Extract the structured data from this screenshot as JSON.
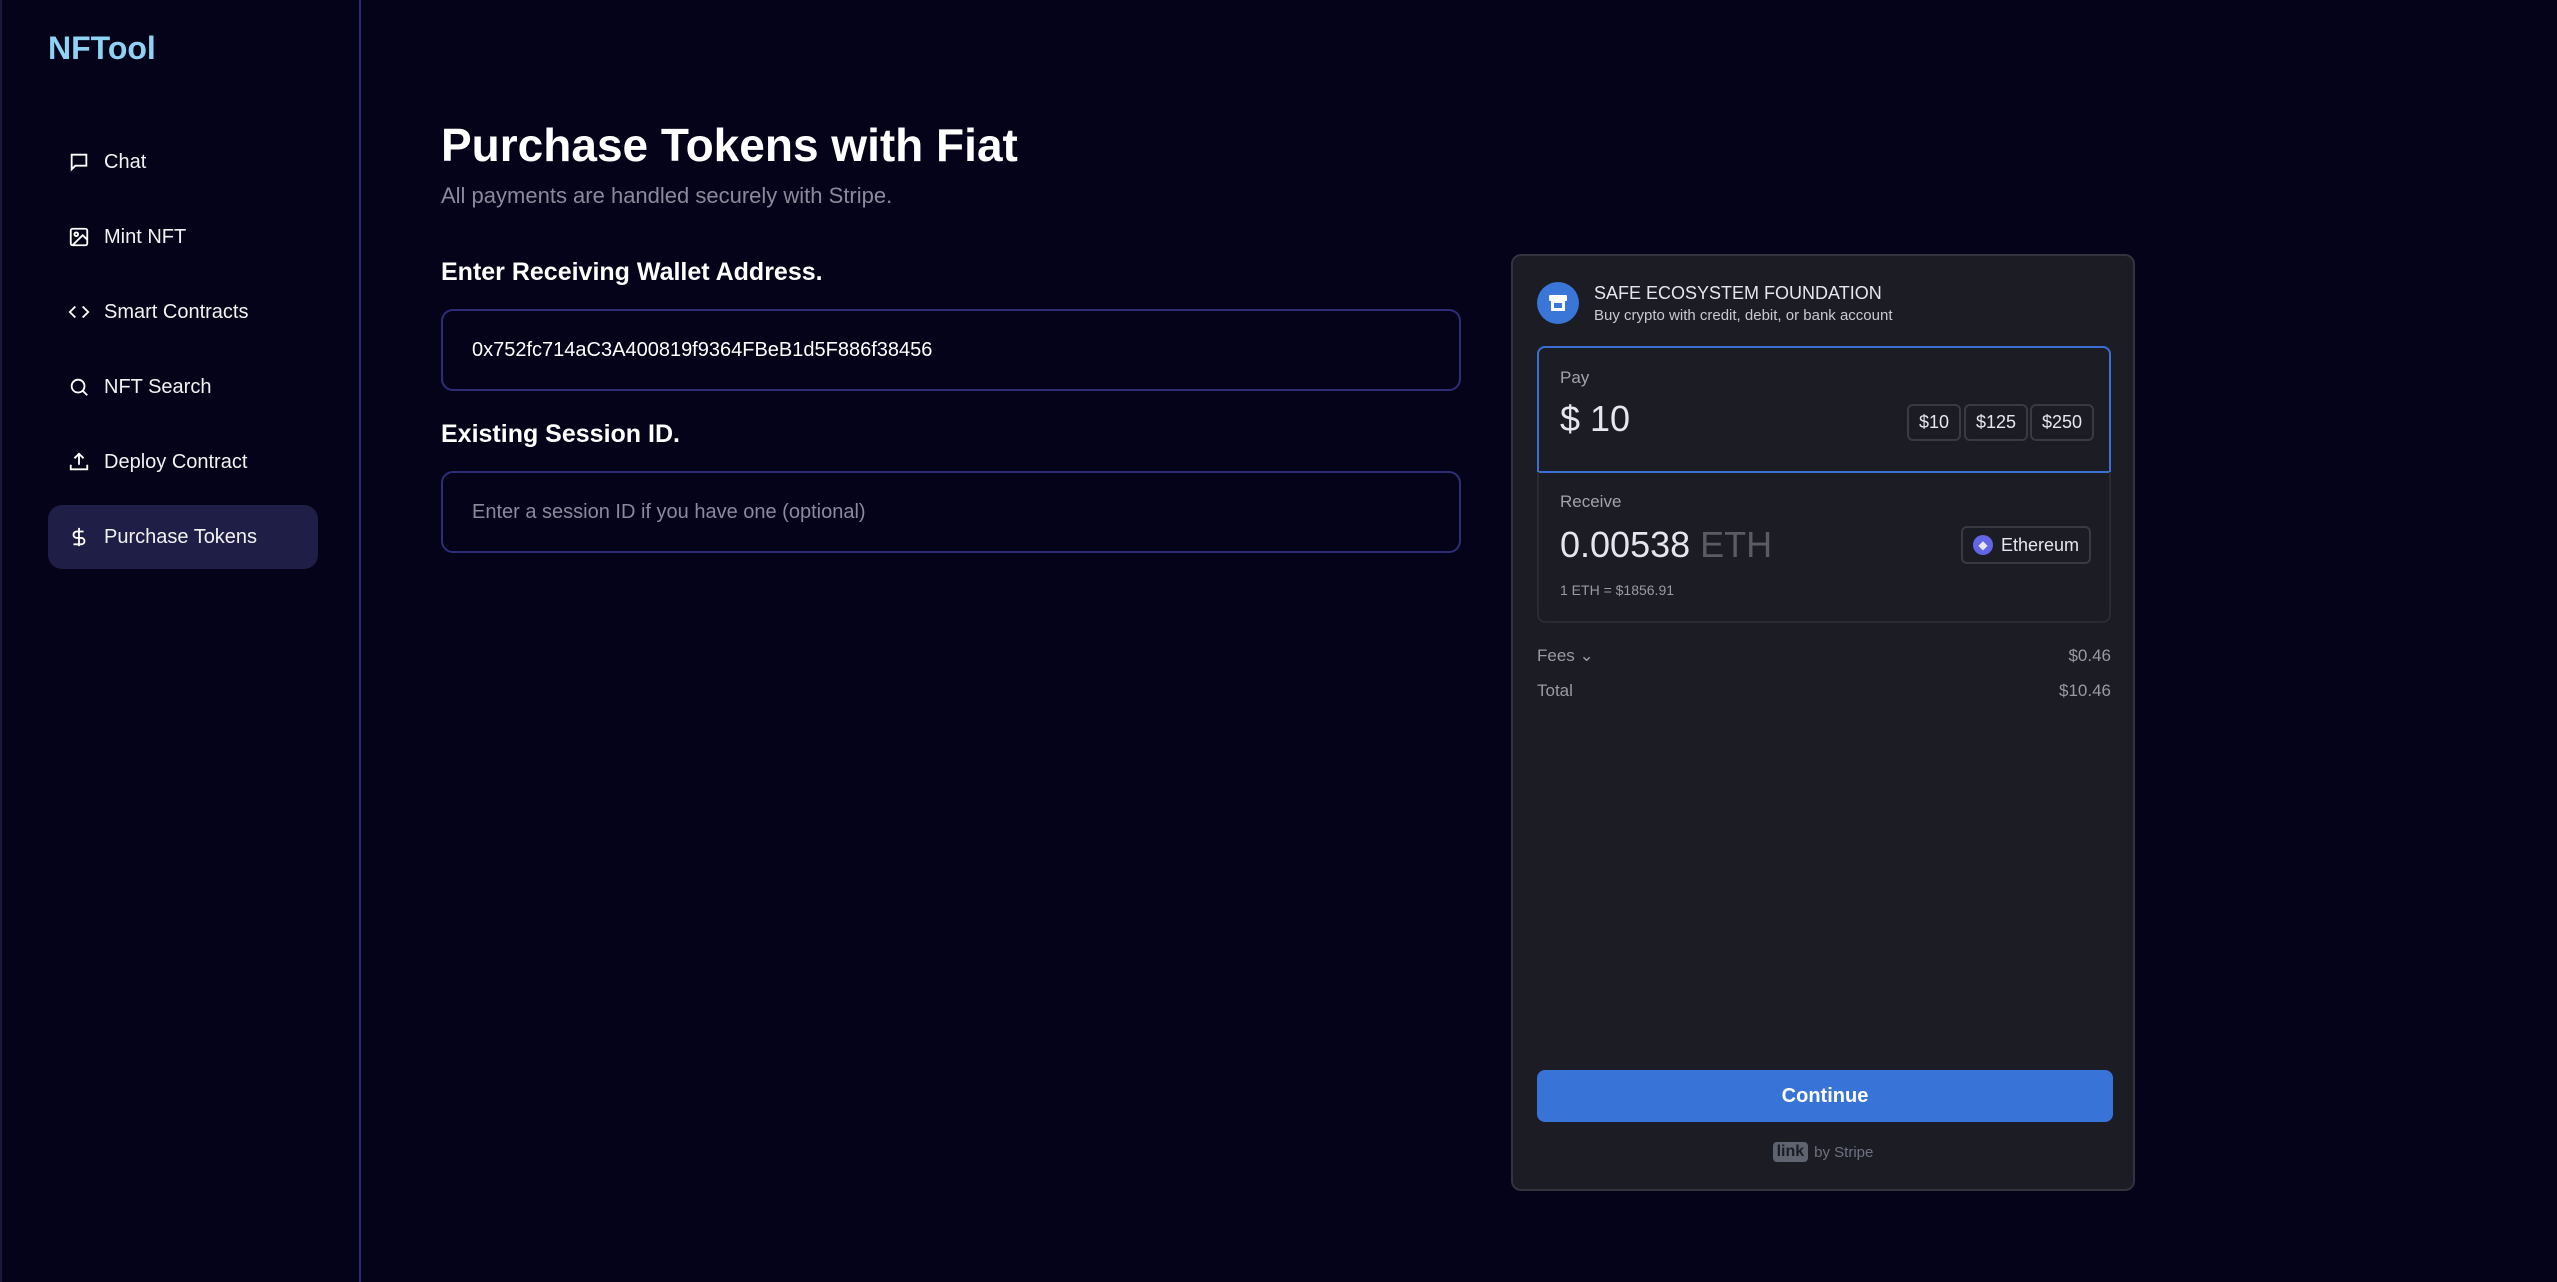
{
  "app": {
    "logo": "NFTool"
  },
  "sidebar": {
    "items": [
      {
        "label": "Chat",
        "icon": "chat-icon"
      },
      {
        "label": "Mint NFT",
        "icon": "image-icon"
      },
      {
        "label": "Smart Contracts",
        "icon": "code-icon"
      },
      {
        "label": "NFT Search",
        "icon": "search-icon"
      },
      {
        "label": "Deploy Contract",
        "icon": "upload-icon"
      },
      {
        "label": "Purchase Tokens",
        "icon": "dollar-icon",
        "active": true
      }
    ]
  },
  "main": {
    "title": "Purchase Tokens with Fiat",
    "subtitle": "All payments are handled securely with Stripe.",
    "wallet_label": "Enter Receiving Wallet Address.",
    "wallet_value": "0x752fc714aC3A400819f9364FBeB1d5F886f38456",
    "session_label": "Existing Session ID.",
    "session_placeholder": "Enter a session ID if you have one (optional)"
  },
  "onramp": {
    "merchant": "SAFE ECOSYSTEM FOUNDATION",
    "description": "Buy crypto with credit, debit, or bank account",
    "pay_label": "Pay",
    "pay_amount": "$ 10",
    "presets": [
      "$10",
      "$125",
      "$250"
    ],
    "receive_label": "Receive",
    "receive_amount": "0.00538",
    "receive_unit": "ETH",
    "network": "Ethereum",
    "rate": "1 ETH = $1856.91",
    "fees_label": "Fees",
    "fees_value": "$0.46",
    "total_label": "Total",
    "total_value": "$10.46",
    "continue_label": "Continue",
    "link_logo": "link",
    "powered_by": "by Stripe",
    "accent": "#3873d8"
  }
}
